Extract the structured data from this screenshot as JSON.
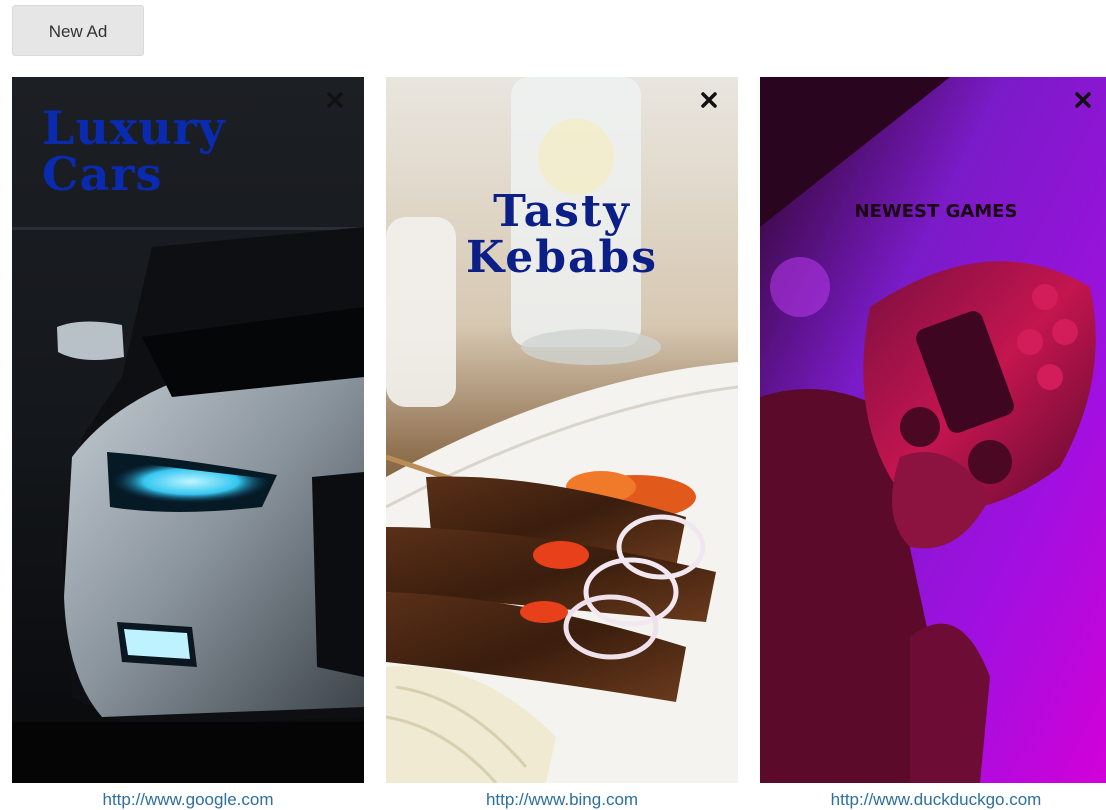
{
  "toolbar": {
    "new_ad_label": "New Ad"
  },
  "ads": [
    {
      "title_line1": "Luxury",
      "title_line2": "Cars",
      "url": "http://www.google.com",
      "title_color": "#0a2bb0",
      "close_icon": "close-icon"
    },
    {
      "title_line1": "Tasty",
      "title_line2": "Kebabs",
      "url": "http://www.bing.com",
      "title_color": "#0b1f86",
      "close_icon": "close-icon"
    },
    {
      "title": "NEWEST GAMES",
      "url": "http://www.duckduckgo.com",
      "title_color": "#1a0010",
      "close_icon": "close-icon"
    }
  ],
  "colors": {
    "link": "#2d6f9f",
    "button_bg": "#e6e6e6"
  }
}
